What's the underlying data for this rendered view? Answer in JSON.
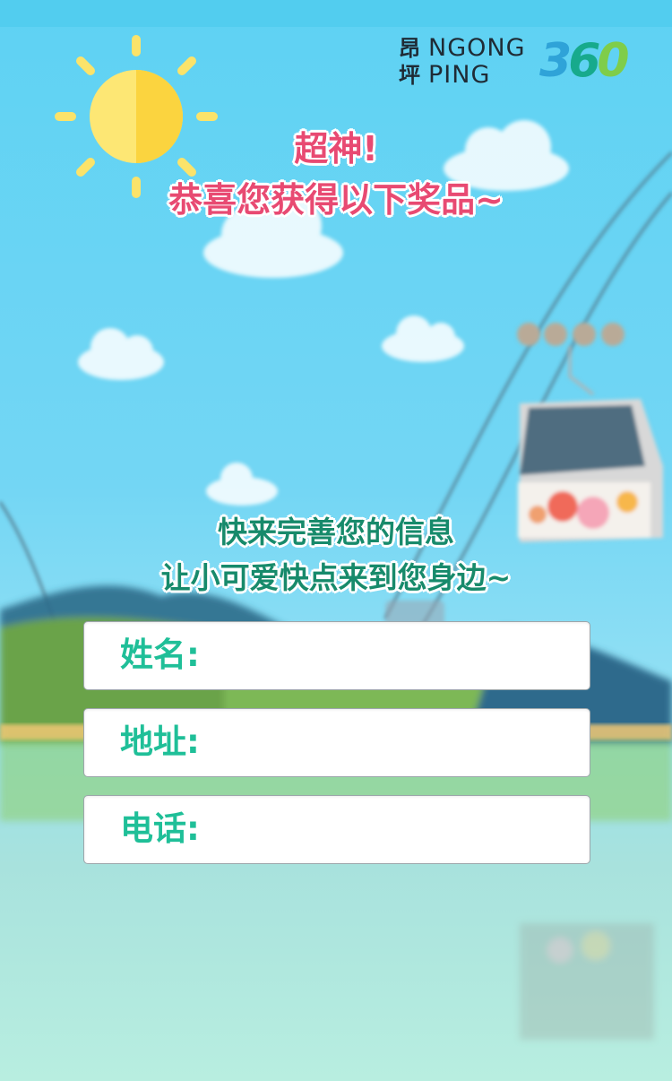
{
  "logo": {
    "cn_top": "昂",
    "cn_bottom": "坪",
    "en_top": "NGONG",
    "en_bottom": "PING",
    "num_3": "3",
    "num_6": "6",
    "num_0": "0"
  },
  "headline": {
    "line1": "超神!",
    "line2": "恭喜您获得以下奖品~"
  },
  "prompt": {
    "line1": "快来完善您的信息",
    "line2": "让小可爱快点来到您身边~"
  },
  "form": {
    "name_label": "姓名:",
    "address_label": "地址:",
    "phone_label": "电话:",
    "name_value": "",
    "address_value": "",
    "phone_value": ""
  },
  "colors": {
    "headline": "#e84a72",
    "prompt": "#178a6b",
    "field_label": "#1fbf98",
    "sky": "#5ed2f3"
  }
}
